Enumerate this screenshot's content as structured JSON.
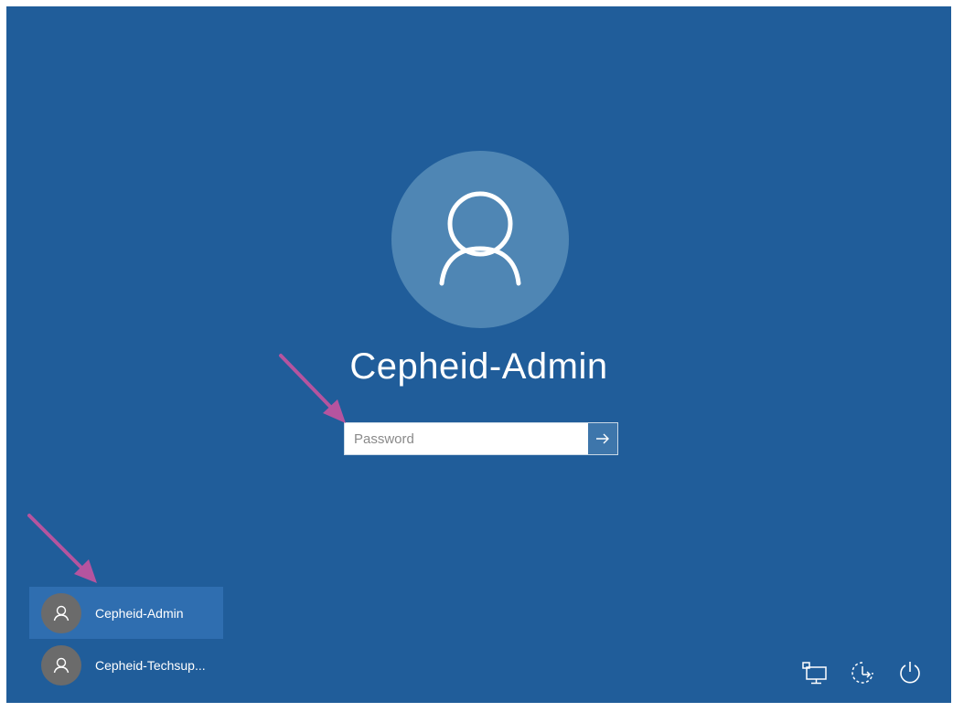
{
  "login": {
    "username": "Cepheid-Admin",
    "password_placeholder": "Password",
    "password_value": ""
  },
  "users": [
    {
      "name": "Cepheid-Admin",
      "selected": true
    },
    {
      "name": "Cepheid-Techsup...",
      "selected": false
    }
  ],
  "corner_icons": [
    "network-icon",
    "ease-of-access-icon",
    "power-icon"
  ],
  "colors": {
    "background": "#205d9a",
    "avatar_circle": "#4f86b4",
    "selected_user": "#2f6eb0",
    "submit_button": "#3e76ab",
    "annotation_arrow": "#b5549f"
  }
}
